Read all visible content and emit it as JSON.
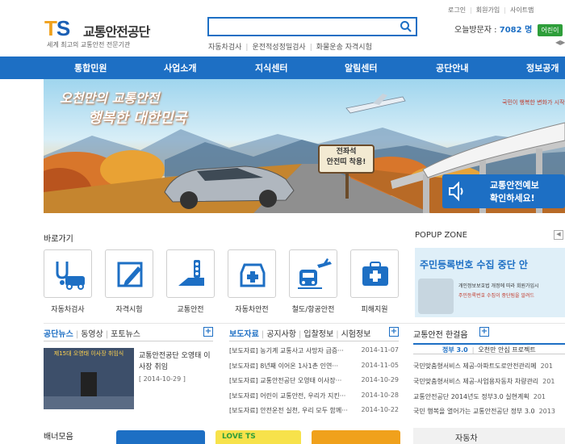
{
  "header": {
    "logo_mark": "TS",
    "logo_name": "교통안전공단",
    "slogan": "세계 최고의 교통안전 전문기관",
    "search_placeholder": "",
    "quick_links": [
      "자동차검사",
      "운전적성정밀검사",
      "화물운송 자격시험"
    ],
    "top_links": [
      "로그인",
      "회원가입",
      "사이트맵"
    ],
    "visitor_label": "오늘방문자 :",
    "visitor_count": "7082 명",
    "visitor_btn": "어린이"
  },
  "nav": [
    "통합민원",
    "사업소개",
    "지식센터",
    "알림센터",
    "공단안내",
    "정보공개"
  ],
  "banner": {
    "headline1": "오천만의 교통안전",
    "headline2": "행복한 대한민국",
    "sign": "전좌석\n안전띠 착용!",
    "cta1": "교통안전예보",
    "cta2": "확인하세요!",
    "side_text": "국민이 행복한 변화가 시작됩"
  },
  "shortcuts": {
    "title": "바로가기",
    "items": [
      "자동차검사",
      "자격시험",
      "교통안전",
      "자동차안전",
      "철도/항공안전",
      "피해지원"
    ]
  },
  "popup": {
    "title": "POPUP ZONE",
    "headline": "주민등록번호 수집 중단 안",
    "line1": "개인정보보호법 개정에 따라 회원가입시",
    "line2": "주민등록번호 수집이 중단됨을 알려드"
  },
  "news": {
    "tabs": [
      "공단뉴스",
      "동영상",
      "포토뉴스"
    ],
    "photo_title1": "교통안전공단 오영태 이",
    "photo_title2": "사장 취임",
    "photo_date": "[ 2014-10-29 ]",
    "photo_caption": "제15대 오영태 이사장 취임식"
  },
  "press": {
    "tabs": [
      "보도자료",
      "공지사항",
      "입찰정보",
      "시험정보"
    ],
    "rows": [
      {
        "text": "[보도자료] 농기계 교통사고 사망자 급증···",
        "date": "2014-11-07"
      },
      {
        "text": "[보도자료] 8년째 이어온 1사1촌 인연···",
        "date": "2014-11-05"
      },
      {
        "text": "[보도자료] 교통안전공단 오영태 이사장···",
        "date": "2014-10-29"
      },
      {
        "text": "[보도자료] 어린이 교통안전, 우리가 지킨···",
        "date": "2014-10-28"
      },
      {
        "text": "[보도자료] 안전운전 실천, 우리 모두 함께···",
        "date": "2014-10-22"
      }
    ]
  },
  "column": {
    "title": "교통안전 한걸음",
    "highlight_a": "정부 3.0",
    "highlight_b": "오천만 안심 프로젝트",
    "rows": [
      "국민맞춤형서비스 제공-아파트도로안전관리메",
      "국민맞춤형서비스 제공-사업용자동차 차량관리",
      "교통안전공단 2014년도 정부3.0 실현계획",
      "국민 행복을 열어가는 교통안전공단 정부 3.0"
    ],
    "row_suffix": [
      "201",
      "201",
      "201",
      "2013"
    ]
  },
  "banner_zone": {
    "title": "배너모음",
    "b1": "LOVE TS",
    "b4": "자동차"
  },
  "colors": {
    "primary": "#1d6fc4",
    "accent": "#f0a11c",
    "green": "#2e9e3a"
  }
}
